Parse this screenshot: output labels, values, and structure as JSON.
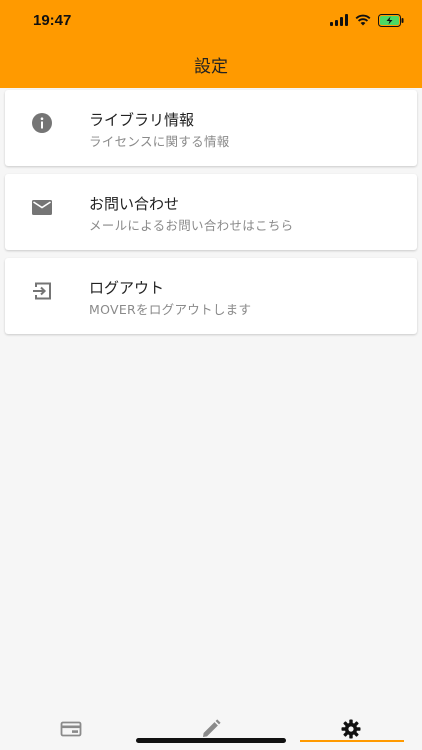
{
  "status_bar": {
    "time": "19:47"
  },
  "header": {
    "title": "設定"
  },
  "settings": [
    {
      "icon": "info-icon",
      "title": "ライブラリ情報",
      "subtitle": "ライセンスに関する情報"
    },
    {
      "icon": "mail-icon",
      "title": "お問い合わせ",
      "subtitle": "メールによるお問い合わせはこちら"
    },
    {
      "icon": "logout-icon",
      "title": "ログアウト",
      "subtitle": "MOVERをログアウトします"
    }
  ],
  "tabs": [
    {
      "icon": "card-icon",
      "active": false
    },
    {
      "icon": "pencil-icon",
      "active": false
    },
    {
      "icon": "gear-icon",
      "active": true
    }
  ],
  "colors": {
    "accent": "#ff9a00",
    "background": "#f6f6f6"
  }
}
